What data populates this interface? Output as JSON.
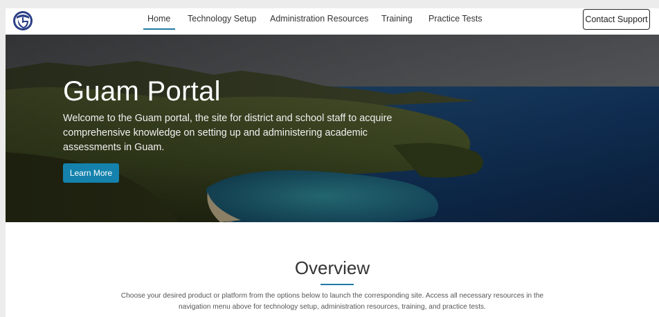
{
  "nav": {
    "items": [
      {
        "label": "Home",
        "active": true
      },
      {
        "label": "Technology Setup",
        "active": false
      },
      {
        "label": "Administration Resources",
        "active": false
      },
      {
        "label": "Training",
        "active": false
      },
      {
        "label": "Practice Tests",
        "active": false
      }
    ],
    "contact_label": "Contact Support",
    "accent_color": "#1d7aa6"
  },
  "logo": {
    "icon": "guam-seal-logo"
  },
  "hero": {
    "title": "Guam Portal",
    "text": "Welcome to the Guam portal, the site for district and school staff to acquire comprehensive knowledge on setting up and administering academic assessments in Guam.",
    "button_label": "Learn More",
    "button_color": "#1482ad"
  },
  "overview": {
    "title": "Overview",
    "text": "Choose your desired product or platform from the options below to launch the corresponding site. Access all necessary resources in the navigation menu above for technology setup, administration resources, training, and practice tests."
  }
}
